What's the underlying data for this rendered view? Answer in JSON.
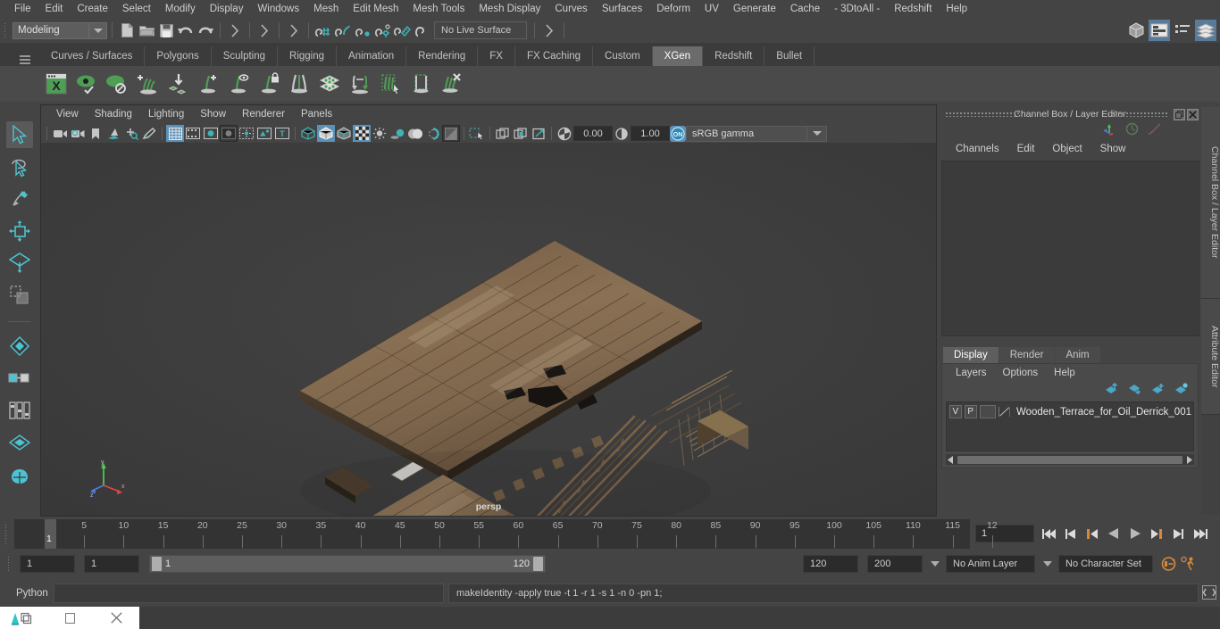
{
  "menubar": {
    "items": [
      "File",
      "Edit",
      "Create",
      "Select",
      "Modify",
      "Display",
      "Windows",
      "Mesh",
      "Edit Mesh",
      "Mesh Tools",
      "Mesh Display",
      "Curves",
      "Surfaces",
      "Deform",
      "UV",
      "Generate",
      "Cache",
      "- 3DtoAll -",
      "Redshift",
      "Help"
    ]
  },
  "statusline": {
    "mode": "Modeling",
    "live_surface": "No Live Surface",
    "icons": [
      "new-scene-icon",
      "open-scene-icon",
      "save-scene-icon",
      "undo-icon",
      "redo-icon",
      "select-by-hierarchy-icon",
      "select-by-object-icon",
      "select-by-component-icon",
      "snap-to-grid-icon",
      "snap-to-curve-icon",
      "snap-to-point-icon",
      "snap-to-projected-center-icon",
      "snap-to-view-plane-icon",
      "make-live-icon"
    ],
    "right_icons": [
      "show-hide-modeling-toolkit-icon",
      "show-hide-attribute-editor-icon",
      "show-hide-tool-settings-icon",
      "show-hide-channel-box-icon"
    ]
  },
  "shelf": {
    "tabs": [
      "Curves / Surfaces",
      "Polygons",
      "Sculpting",
      "Rigging",
      "Animation",
      "Rendering",
      "FX",
      "FX Caching",
      "Custom",
      "XGen",
      "Redshift",
      "Bullet"
    ],
    "active_tab": "XGen",
    "icons": [
      "xgen-editor-icon",
      "xgen-preview-on-icon",
      "xgen-preview-off-icon",
      "xgen-add-description-icon",
      "xgen-import-collection-icon",
      "xgen-add-guide-icon",
      "xgen-guide-display-icon",
      "xgen-freeze-guide-icon",
      "xgen-mirror-guide-icon",
      "xgen-sculpt-layer-icon",
      "xgen-convert-guide-icon",
      "xgen-select-guide-icon",
      "xgen-select-region-icon",
      "xgen-delete-guide-icon"
    ]
  },
  "toolbox": {
    "tools": [
      "select-tool",
      "lasso-select-tool",
      "paint-select-tool",
      "move-tool",
      "rotate-tool",
      "scale-tool",
      "last-tool-used",
      "show-manipulator-tool",
      "component-editor-tool"
    ]
  },
  "viewport": {
    "menus": [
      "View",
      "Shading",
      "Lighting",
      "Show",
      "Renderer",
      "Panels"
    ],
    "exposure_value": "0.00",
    "gamma_value": "1.00",
    "color_management": "sRGB gamma",
    "color_management_toggle": "ON",
    "camera_label": "persp",
    "axis_labels": [
      "x",
      "y",
      "z"
    ],
    "toolbar_icons": [
      "select-camera-icon",
      "camera-attributes-icon",
      "bookmark-icon",
      "image-plane-icon",
      "two-d-pan-zoom-icon",
      "grease-pencil-icon",
      "grid-icon",
      "film-gate-icon",
      "resolution-gate-icon",
      "gate-mask-icon",
      "field-chart-icon",
      "safe-action-icon",
      "safe-title-icon",
      "wireframe-icon",
      "smooth-shade-all-icon",
      "shaded-wireframe-icon",
      "textured-icon",
      "use-all-lights-icon",
      "shadows-icon",
      "screen-space-ao-icon",
      "motion-blur-icon",
      "multisample-aa-icon",
      "depth-of-field-icon",
      "isolate-select-icon",
      "xray-icon",
      "xray-joints-icon",
      "xray-active-components-icon",
      "exposure-icon",
      "gamma-icon"
    ]
  },
  "right_panel": {
    "title": "Channel Box / Layer Editor",
    "menus": [
      "Channels",
      "Edit",
      "Object",
      "Show"
    ],
    "header_icons": [
      "axis-orientation-icon",
      "speed-icon",
      "curve-icon"
    ],
    "layer_tabs": [
      "Display",
      "Render",
      "Anim"
    ],
    "active_layer_tab": "Display",
    "layer_menus": [
      "Layers",
      "Options",
      "Help"
    ],
    "layer_toolbar_icons": [
      "move-layer-up-icon",
      "move-layer-down-icon",
      "new-layer-icon",
      "new-layer-from-selected-icon"
    ],
    "layers": [
      {
        "visibility": "V",
        "playback": "P",
        "shading": "",
        "name": "Wooden_Terrace_for_Oil_Derrick_001"
      }
    ],
    "side_tabs": [
      "Channel Box / Layer Editor",
      "Attribute Editor"
    ]
  },
  "timeline": {
    "tick_labels": [
      "5",
      "10",
      "15",
      "20",
      "25",
      "30",
      "35",
      "40",
      "45",
      "50",
      "55",
      "60",
      "65",
      "70",
      "75",
      "80",
      "85",
      "90",
      "95",
      "100",
      "105",
      "110",
      "115",
      "12"
    ],
    "current_frame_marker": "1",
    "current_frame_field": "1",
    "playback_buttons": [
      "go-to-start-icon",
      "step-back-frame-icon",
      "step-back-key-icon",
      "play-backwards-icon",
      "play-forwards-icon",
      "step-forward-key-icon",
      "step-forward-frame-icon",
      "go-to-end-icon"
    ]
  },
  "range": {
    "anim_start": "1",
    "range_start": "1",
    "slider_min_label": "1",
    "slider_max_label": "120",
    "range_end": "120",
    "anim_end": "200",
    "anim_layer": "No Anim Layer",
    "character_set": "No Character Set",
    "right_icons": [
      "auto-key-icon",
      "animation-preferences-icon"
    ]
  },
  "command_line": {
    "language_label": "Python",
    "input_value": "",
    "output_value": "makeIdentity -apply true -t 1 -r 1 -s 1 -n 0 -pn 1;",
    "script_editor_icon": "script-editor-icon"
  },
  "taskbar": {
    "buttons": [
      "maya-app-icon",
      "restore-window-icon",
      "close-window-icon"
    ]
  },
  "colors": {
    "accent_blue": "#5b90b8",
    "xgen_green": "#4e9e55",
    "panel_bg": "#444444",
    "viewport_bg": "#3b3b3b",
    "orange": "#d98836"
  }
}
